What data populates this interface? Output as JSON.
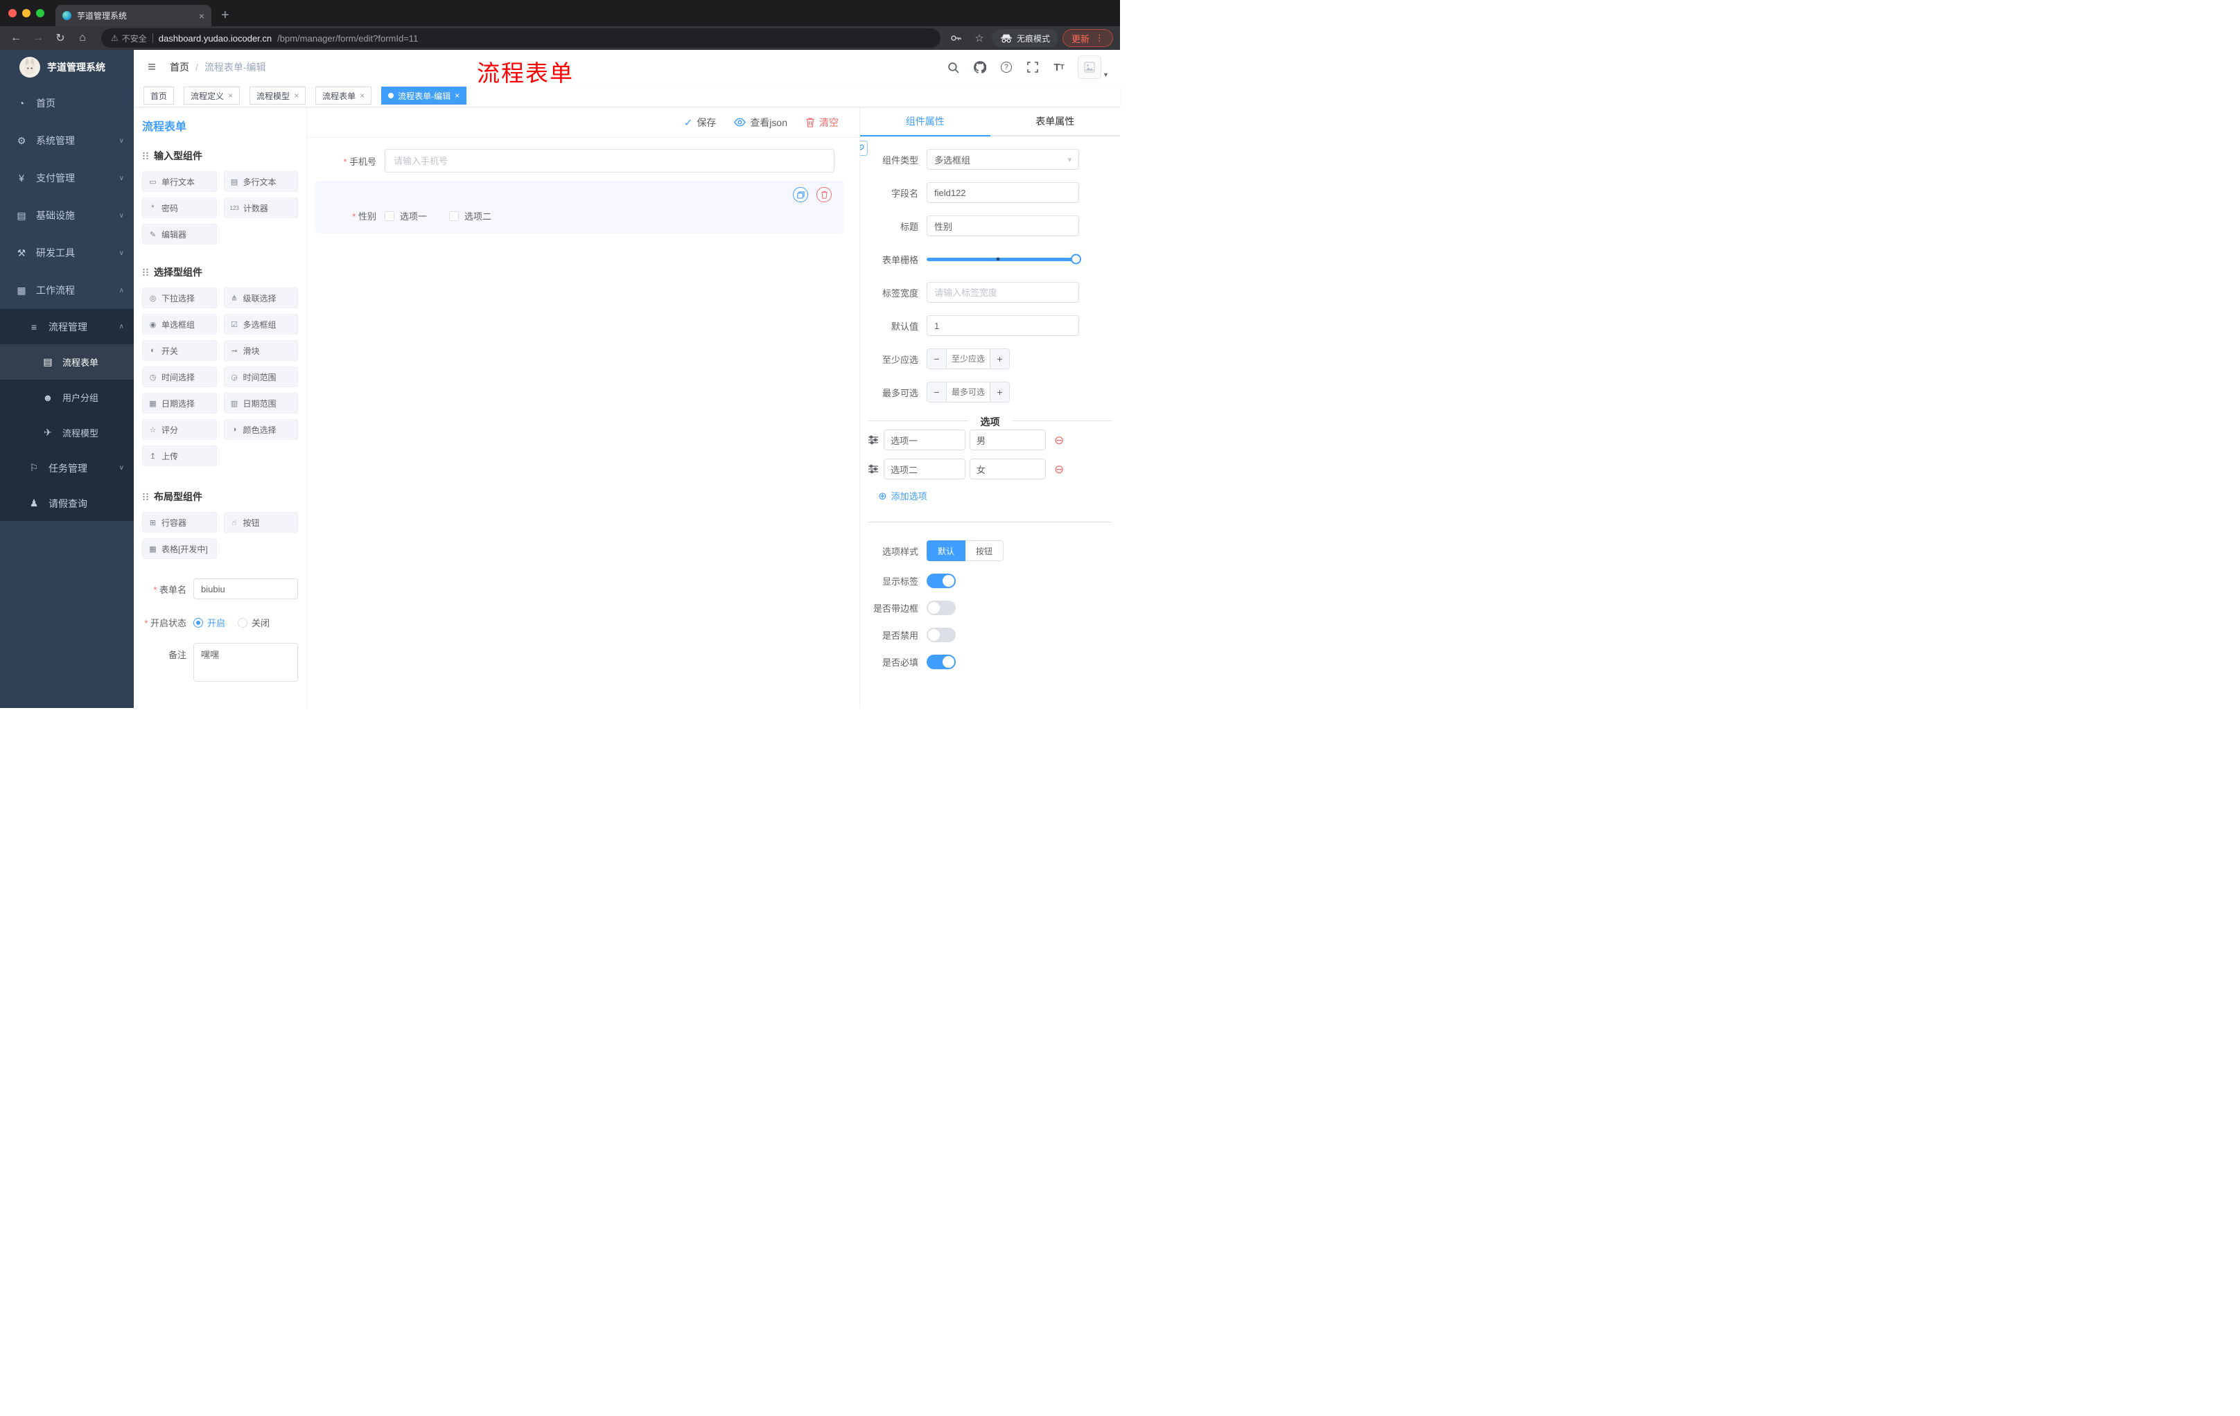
{
  "browser": {
    "tab": {
      "title": "芋道管理系统"
    },
    "toolbar": {
      "security_label": "不安全",
      "url_host": "dashboard.yudao.iocoder.cn",
      "url_path": "/bpm/manager/form/edit?formId=11",
      "incognito_label": "无痕模式",
      "update_label": "更新"
    }
  },
  "sidebar": {
    "title": "芋道管理系统",
    "items": [
      {
        "icon": "◔",
        "label": "首页"
      },
      {
        "icon": "⚙",
        "label": "系统管理",
        "chevron": "∨"
      },
      {
        "icon": "¥",
        "label": "支付管理",
        "chevron": "∨"
      },
      {
        "icon": "▤",
        "label": "基础设施",
        "chevron": "∨"
      },
      {
        "icon": "⚒",
        "label": "研发工具",
        "chevron": "∨"
      },
      {
        "icon": "▦",
        "label": "工作流程",
        "chevron": "∧"
      },
      {
        "icon": "≡",
        "label": "流程管理",
        "chevron": "∧"
      },
      {
        "icon": "▤",
        "label": "流程表单"
      },
      {
        "icon": "☻",
        "label": "用户分组"
      },
      {
        "icon": "✈",
        "label": "流程模型"
      },
      {
        "icon": "⚐",
        "label": "任务管理",
        "chevron": "∨"
      },
      {
        "icon": "♟",
        "label": "请假查询"
      }
    ]
  },
  "header": {
    "breadcrumb_home": "首页",
    "breadcrumb_sep": "/",
    "breadcrumb_current": "流程表单-编辑",
    "annotation": "流程表单"
  },
  "tags": [
    {
      "label": "首页"
    },
    {
      "label": "流程定义"
    },
    {
      "label": "流程模型"
    },
    {
      "label": "流程表单"
    },
    {
      "label": "流程表单-编辑"
    }
  ],
  "designer": {
    "panel_title": "流程表单",
    "toolbar": {
      "save": "保存",
      "view_json": "查看json",
      "clear": "清空"
    },
    "groups": [
      {
        "title": "输入型组件",
        "items": [
          {
            "icon": "▭",
            "label": "单行文本"
          },
          {
            "icon": "▤",
            "label": "多行文本"
          },
          {
            "icon": "*",
            "label": "密码"
          },
          {
            "icon": "123",
            "label": "计数器"
          },
          {
            "icon": "✎",
            "label": "编辑器"
          }
        ]
      },
      {
        "title": "选择型组件",
        "items": [
          {
            "icon": "◎",
            "label": "下拉选择"
          },
          {
            "icon": "⋔",
            "label": "级联选择"
          },
          {
            "icon": "◉",
            "label": "单选框组"
          },
          {
            "icon": "☑",
            "label": "多选框组"
          },
          {
            "icon": "◐",
            "label": "开关"
          },
          {
            "icon": "⊸",
            "label": "滑块"
          },
          {
            "icon": "◷",
            "label": "时间选择"
          },
          {
            "icon": "◶",
            "label": "时间范围"
          },
          {
            "icon": "▦",
            "label": "日期选择"
          },
          {
            "icon": "▥",
            "label": "日期范围"
          },
          {
            "icon": "☆",
            "label": "评分"
          },
          {
            "icon": "◑",
            "label": "颜色选择"
          },
          {
            "icon": "↥",
            "label": "上传"
          }
        ]
      },
      {
        "title": "布局型组件",
        "items": [
          {
            "icon": "⊞",
            "label": "行容器"
          },
          {
            "icon": "☝",
            "label": "按钮"
          },
          {
            "icon": "▦",
            "label": "表格[开发中]"
          }
        ]
      }
    ],
    "meta": {
      "name_label": "表单名",
      "name_value": "biubiu",
      "status_label": "开启状态",
      "status_on": "开启",
      "status_off": "关闭",
      "remark_label": "备注",
      "remark_value": "嘿嘿"
    },
    "canvas": {
      "phone": {
        "label": "手机号",
        "placeholder": "请输入手机号"
      },
      "gender": {
        "label": "性别",
        "options": [
          "选项一",
          "选项二"
        ]
      }
    }
  },
  "props": {
    "tab_component": "组件属性",
    "tab_form": "表单属性",
    "component_type": {
      "label": "组件类型",
      "value": "多选框组"
    },
    "field_name": {
      "label": "字段名",
      "value": "field122"
    },
    "title": {
      "label": "标题",
      "value": "性别"
    },
    "grid": {
      "label": "表单栅格"
    },
    "label_width": {
      "label": "标签宽度",
      "placeholder": "请输入标签宽度"
    },
    "default_value": {
      "label": "默认值",
      "value": "1"
    },
    "min_select": {
      "label": "至少应选",
      "placeholder": "至少应选"
    },
    "max_select": {
      "label": "最多可选",
      "placeholder": "最多可选"
    },
    "options_title": "选项",
    "options": [
      {
        "label": "选项一",
        "value": "男"
      },
      {
        "label": "选项二",
        "value": "女"
      }
    ],
    "add_option": "添加选项",
    "option_style": {
      "label": "选项样式",
      "default": "默认",
      "button": "按钮"
    },
    "switches": [
      {
        "label": "显示标签",
        "on": true
      },
      {
        "label": "是否带边框",
        "on": false
      },
      {
        "label": "是否禁用",
        "on": false
      },
      {
        "label": "是否必填",
        "on": true
      }
    ],
    "colors": {
      "accent": "#409eff",
      "danger": "#f56c6c"
    }
  }
}
